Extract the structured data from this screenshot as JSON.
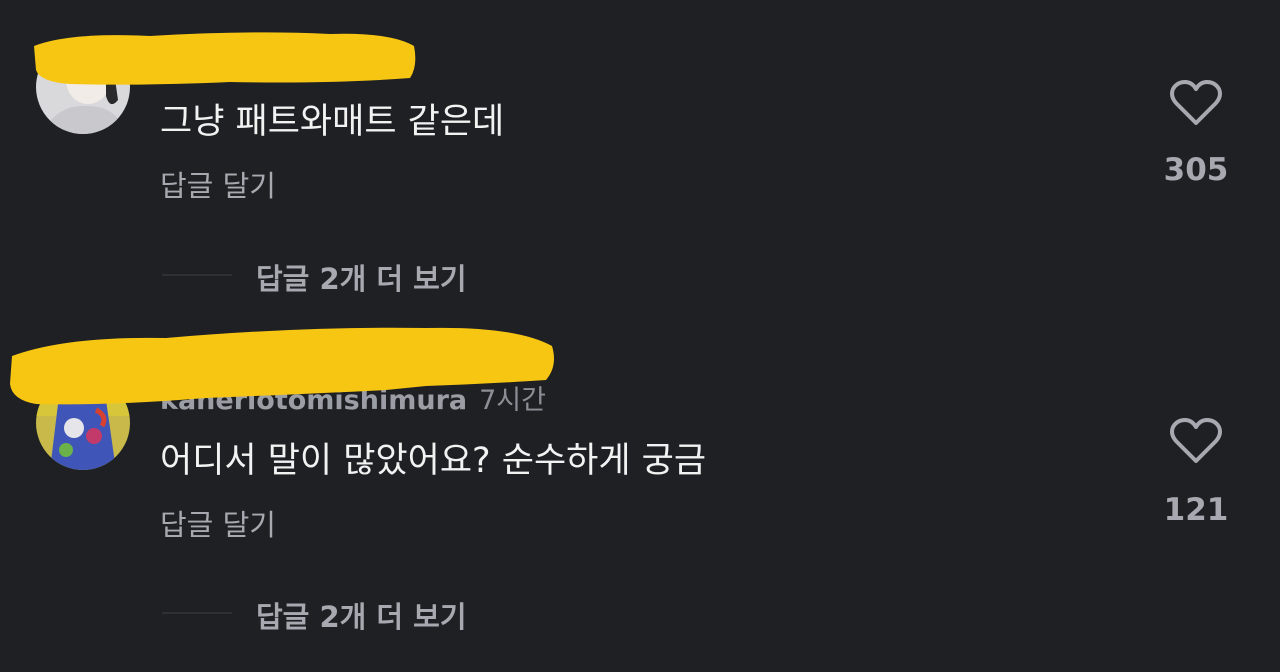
{
  "comments": [
    {
      "username": "",
      "timestamp": "",
      "text": "그냥 패트와매트 같은데",
      "reply_label": "답글 달기",
      "like_count": "305",
      "more_replies": "답글 2개 더 보기"
    },
    {
      "username": "kaneriotomishimura",
      "timestamp": "7시간",
      "text": "어디서 말이 많았어요? 순수하게 궁금",
      "reply_label": "답글 달기",
      "like_count": "121",
      "more_replies": "답글 2개 더 보기"
    }
  ],
  "colors": {
    "background": "#1f2024",
    "redaction": "#f7c613",
    "secondary_text": "#a7a9b0"
  },
  "icons": {
    "like": "heart-outline-icon"
  }
}
